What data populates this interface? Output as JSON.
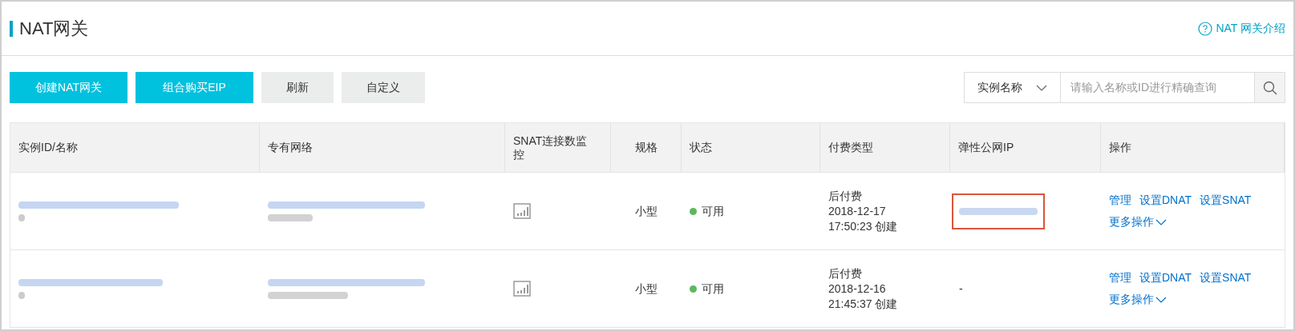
{
  "header": {
    "title": "NAT网关",
    "help_link": "NAT 网关介绍"
  },
  "toolbar": {
    "buttons": [
      {
        "label": "创建NAT网关",
        "kind": "primary"
      },
      {
        "label": "组合购买EIP",
        "kind": "primary"
      },
      {
        "label": "刷新",
        "kind": "secondary"
      },
      {
        "label": "自定义",
        "kind": "secondary"
      }
    ],
    "search_select": "实例名称",
    "search": {
      "placeholder": "请输入名称或ID进行精确查询"
    }
  },
  "table": {
    "columns": [
      "实例ID/名称",
      "专有网络",
      "SNAT连接数监控",
      "规格",
      "状态",
      "付费类型",
      "弹性公网IP",
      "操作"
    ],
    "rows": [
      {
        "spec": "小型",
        "status": "可用",
        "color": "#5cb85c",
        "billing": [
          "后付费",
          "2018-12-17",
          "17:50:23 创建"
        ],
        "eip": {
          "kind": "redacted",
          "highlighted": true
        },
        "actions": [
          "管理",
          "设置DNAT",
          "设置SNAT"
        ],
        "more": "更多操作"
      },
      {
        "spec": "小型",
        "status": "可用",
        "color": "#5cb85c",
        "billing": [
          "后付费",
          "2018-12-16",
          "21:45:37 创建"
        ],
        "eip": {
          "kind": "text",
          "text": "-",
          "highlighted": false
        },
        "actions": [
          "管理",
          "设置DNAT",
          "设置SNAT"
        ],
        "more": "更多操作"
      }
    ]
  }
}
